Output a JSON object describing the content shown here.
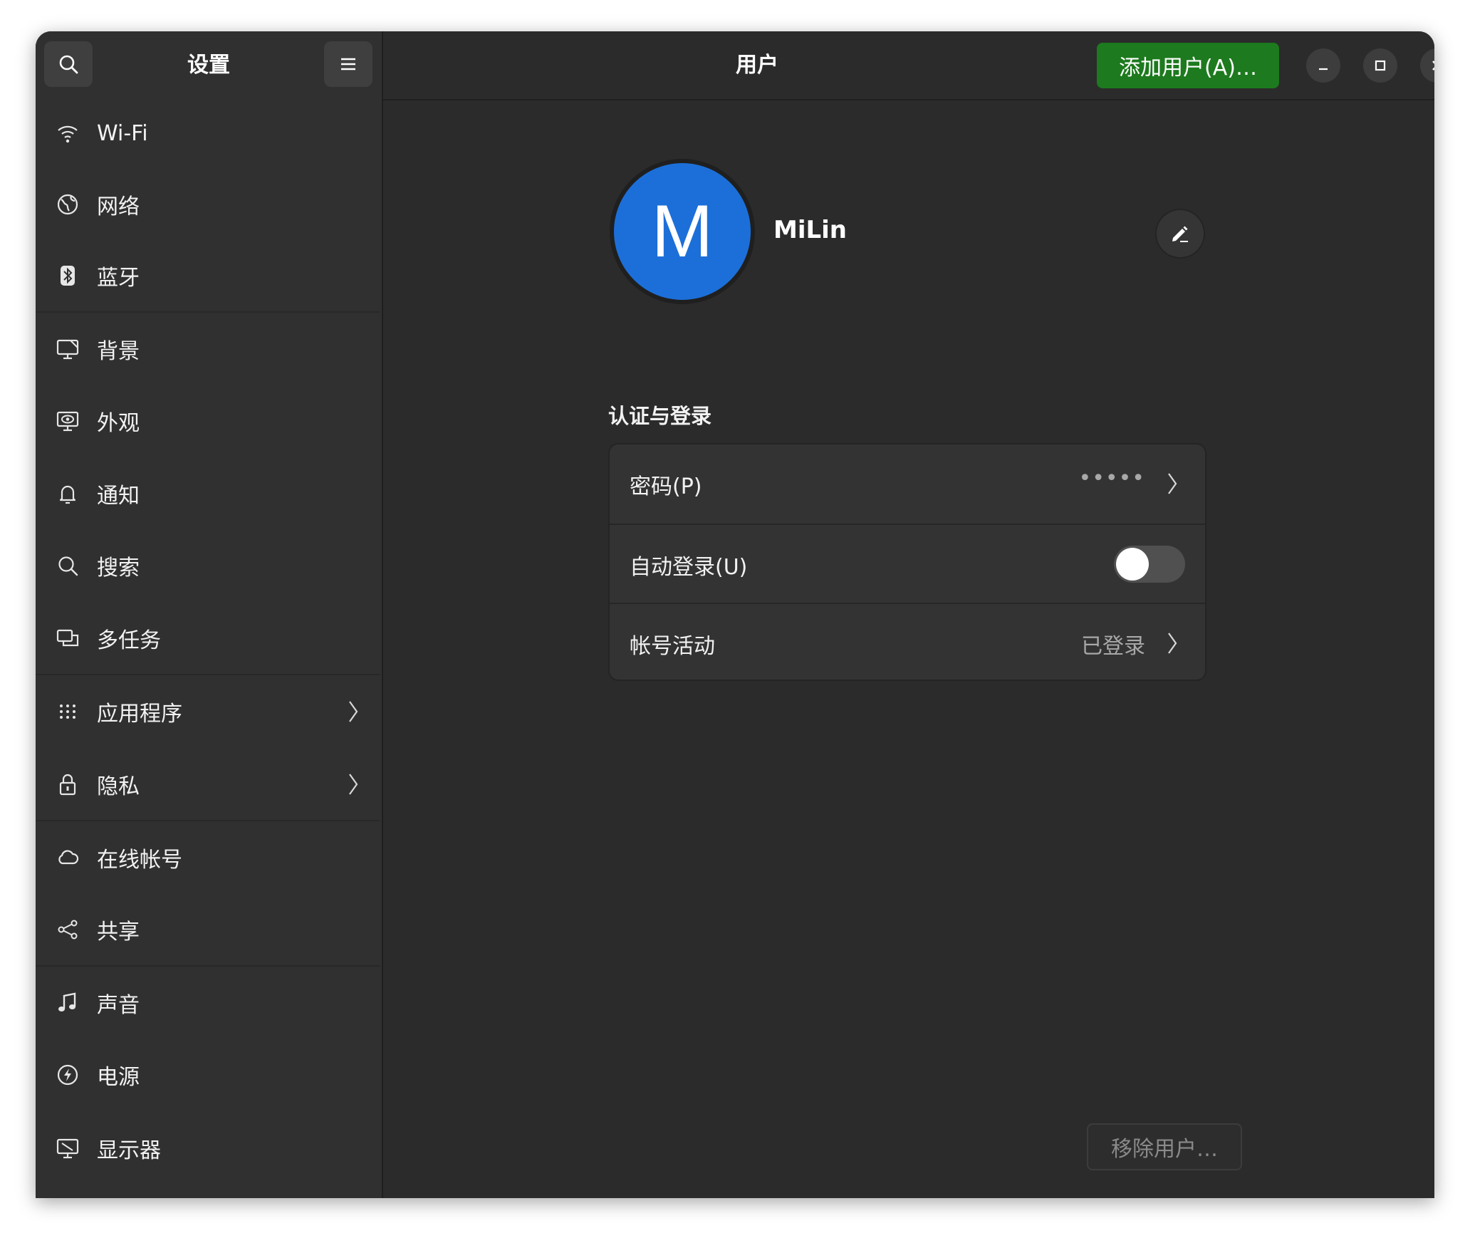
{
  "window": {
    "title": "用户"
  },
  "sidebar": {
    "title": "设置",
    "search_icon": "search-icon",
    "menu_icon": "hamburger-menu-icon",
    "items": [
      {
        "label": "Wi-Fi",
        "icon": "wifi-icon"
      },
      {
        "label": "网络",
        "icon": "globe-icon"
      },
      {
        "label": "蓝牙",
        "icon": "bluetooth-icon"
      },
      {
        "label": "背景",
        "icon": "monitor-background-icon"
      },
      {
        "label": "外观",
        "icon": "appearance-icon"
      },
      {
        "label": "通知",
        "icon": "bell-icon"
      },
      {
        "label": "搜索",
        "icon": "search-icon"
      },
      {
        "label": "多任务",
        "icon": "multitasking-icon"
      },
      {
        "label": "应用程序",
        "icon": "apps-grid-icon",
        "has_submenu": true
      },
      {
        "label": "隐私",
        "icon": "lock-icon",
        "has_submenu": true
      },
      {
        "label": "在线帐号",
        "icon": "cloud-icon"
      },
      {
        "label": "共享",
        "icon": "share-icon"
      },
      {
        "label": "声音",
        "icon": "music-note-icon"
      },
      {
        "label": "电源",
        "icon": "power-icon"
      },
      {
        "label": "显示器",
        "icon": "display-icon"
      }
    ]
  },
  "header": {
    "add_user_label": "添加用户(A)…",
    "add_user_color": "#1d7a1e"
  },
  "user": {
    "avatar_letter": "M",
    "avatar_color": "#1c6fd8",
    "name": "MiLin"
  },
  "auth_section": {
    "title": "认证与登录",
    "rows": [
      {
        "label": "密码(P)",
        "value": "•••••"
      },
      {
        "label": "自动登录(U)",
        "toggle_on": false
      },
      {
        "label": "帐号活动",
        "value": "已登录"
      }
    ]
  },
  "remove_user_label": "移除用户…"
}
